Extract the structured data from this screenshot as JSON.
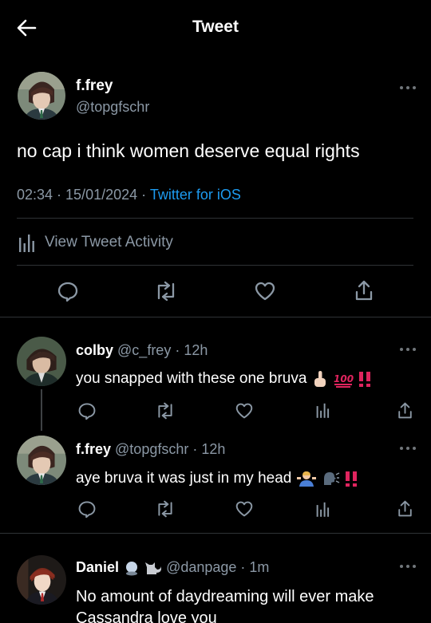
{
  "header": {
    "title": "Tweet"
  },
  "main_tweet": {
    "name": "f.frey",
    "handle": "@topgfschr",
    "text": "no cap i think women deserve equal rights",
    "time": "02:34 · 15/01/2024 ·",
    "source": "Twitter for iOS",
    "activity_label": "View Tweet Activity"
  },
  "replies": [
    {
      "name": "colby",
      "handle": "@c_frey · 12h",
      "text": "you snapped with these one bruva"
    },
    {
      "name": "f.frey",
      "handle": "@topgfschr · 12h",
      "text": "aye bruva it was just in my head"
    },
    {
      "name": "Daniel",
      "handle": "@danpage · 1m",
      "text_line1": "No amount of daydreaming will ever make",
      "text_line2": "Cassandra love you"
    }
  ],
  "colors": {
    "background": "#000000",
    "text": "#e7e9ea",
    "muted": "#8b98a5",
    "link": "#1d9bf0",
    "divider": "#2f3336"
  }
}
